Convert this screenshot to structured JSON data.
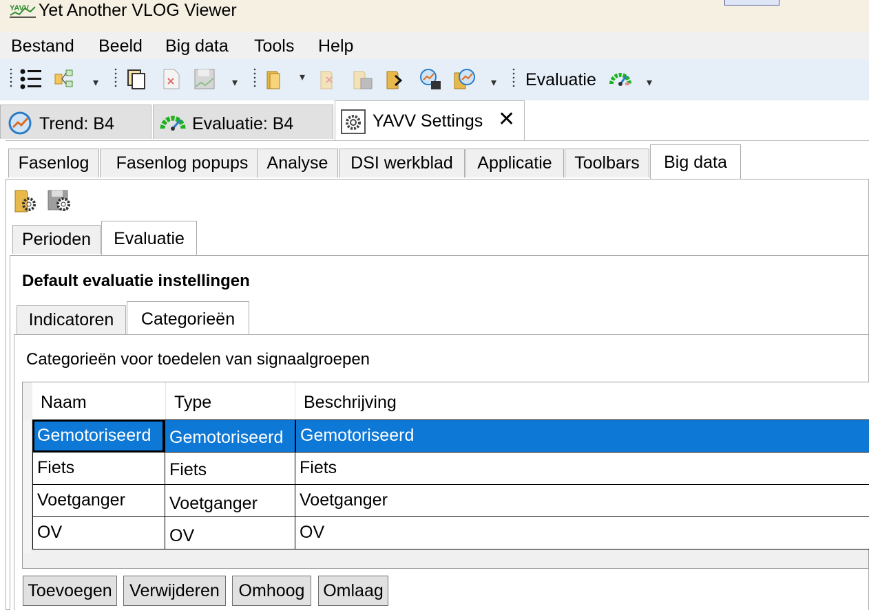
{
  "window": {
    "title": "Yet Another VLOG Viewer",
    "logo_text": "YAVV"
  },
  "menu": [
    "Bestand",
    "Beeld",
    "Big data",
    "Tools",
    "Help"
  ],
  "toolbar": {
    "label": "Evaluatie",
    "overflow": "▾"
  },
  "doc_tabs": [
    {
      "label": "Trend: B4",
      "icon": "trend-icon"
    },
    {
      "label": "Evaluatie: B4",
      "icon": "gauge-icon"
    },
    {
      "label": "YAVV Settings",
      "icon": "settings-icon",
      "close": "✕",
      "active": true
    }
  ],
  "settings_tabs": [
    "Fasenlog",
    "Fasenlog popups",
    "Analyse",
    "DSI werkblad",
    "Applicatie",
    "Toolbars",
    "Big data"
  ],
  "settings_active": "Big data",
  "bigdata_tabs": [
    "Perioden",
    "Evaluatie"
  ],
  "bigdata_active": "Evaluatie",
  "section_title": "Default evaluatie instellingen",
  "eval_tabs": [
    "Indicatoren",
    "Categorieën"
  ],
  "eval_active": "Categorieën",
  "description": "Categorieën voor toedelen van signaalgroepen",
  "grid": {
    "columns": [
      "Naam",
      "Type",
      "Beschrijving"
    ],
    "rows": [
      [
        "Gemotoriseerd",
        "Gemotoriseerd",
        "Gemotoriseerd"
      ],
      [
        "Fiets",
        "Fiets",
        "Fiets"
      ],
      [
        "Voetganger",
        "Voetganger",
        "Voetganger"
      ],
      [
        "OV",
        "OV",
        "OV"
      ]
    ],
    "selected_row": 0
  },
  "buttons": [
    "Toevoegen",
    "Verwijderen",
    "Omhoog",
    "Omlaag"
  ],
  "colors": {
    "selection": "#0e78d6",
    "titlebar": "#f5f0e1",
    "toolbar": "#e6eef8"
  }
}
